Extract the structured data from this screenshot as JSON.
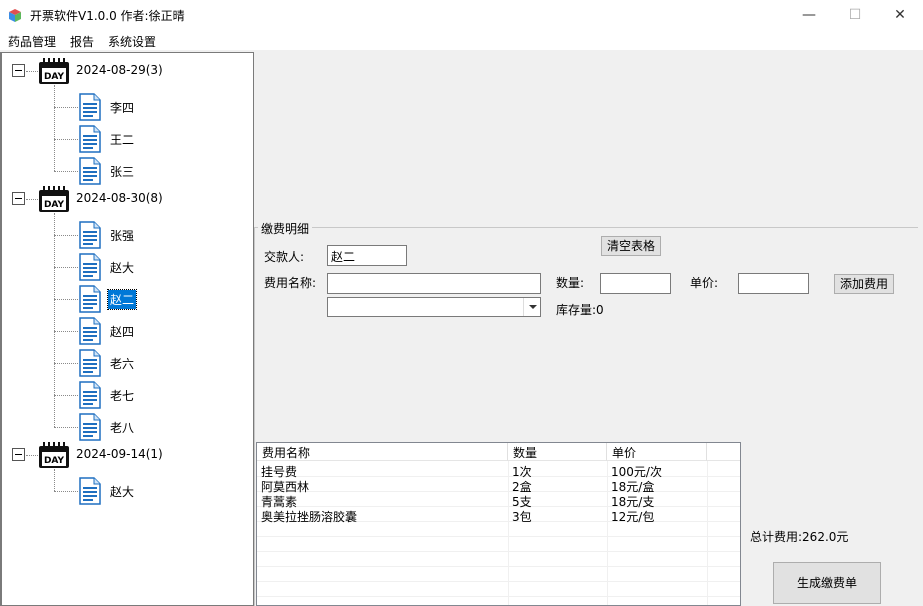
{
  "window": {
    "title": "开票软件V1.0.0 作者:徐正晴",
    "minimize": "—",
    "maximize": "☐",
    "close": "✕"
  },
  "menu": [
    "药品管理",
    "报告",
    "系统设置"
  ],
  "tree": {
    "groups": [
      {
        "date": "2024-08-29(3)",
        "people": [
          "李四",
          "王二",
          "张三"
        ]
      },
      {
        "date": "2024-08-30(8)",
        "people": [
          "张强",
          "赵大",
          "赵二",
          "赵四",
          "老六",
          "老七",
          "老八"
        ]
      },
      {
        "date": "2024-09-14(1)",
        "people": [
          "赵大"
        ]
      }
    ],
    "selected": "赵二",
    "day_icon_text": "DAY"
  },
  "form": {
    "group_title": "缴费明细",
    "payer_label": "交款人:",
    "payer_value": "赵二",
    "clear_button": "清空表格",
    "fee_name_label": "费用名称:",
    "fee_name_value": "",
    "quantity_label": "数量:",
    "quantity_value": "",
    "unit_price_label": "单价:",
    "unit_price_value": "",
    "add_fee_button": "添加费用",
    "dropdown_value": "",
    "stock_label": "库存量:0",
    "total_label": "总计费用:262.0元",
    "generate_button": "生成缴费单"
  },
  "table": {
    "columns": [
      "费用名称",
      "数量",
      "单价"
    ],
    "rows": [
      [
        "挂号费",
        "1次",
        "100元/次"
      ],
      [
        "阿莫西林",
        "2盒",
        "18元/盒"
      ],
      [
        "青蒿素",
        "5支",
        "18元/支"
      ],
      [
        "奥美拉挫肠溶胶囊",
        "3包",
        "12元/包"
      ]
    ]
  }
}
